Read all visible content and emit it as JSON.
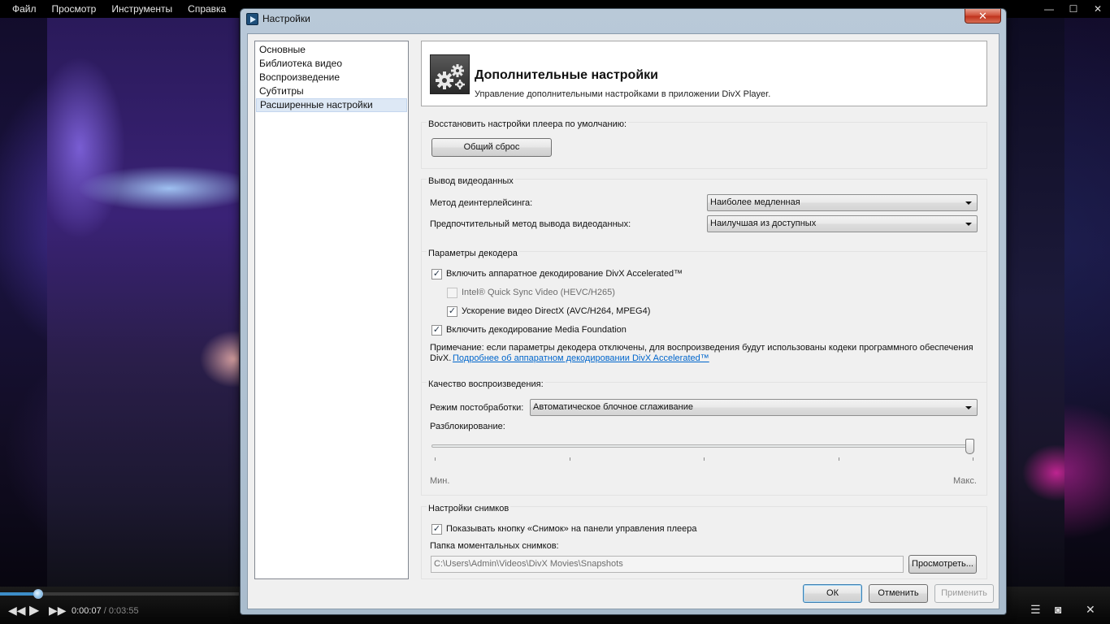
{
  "player": {
    "menu": [
      "Файл",
      "Просмотр",
      "Инструменты",
      "Справка"
    ],
    "window_controls": [
      "—",
      "☐",
      "✕"
    ],
    "time_current": "0:00:07",
    "time_total": " / 0:03:55",
    "progress_fraction": 0.033
  },
  "dialog": {
    "title": "Настройки",
    "close_label": "✕",
    "nav_items": [
      "Основные",
      "Библиотека видео",
      "Воспроизведение",
      "Субтитры",
      "Расширенные настройки"
    ],
    "selected_nav_index": 4,
    "header": {
      "title": "Дополнительные настройки",
      "subtitle": "Управление дополнительными настройками в приложении DivX Player."
    },
    "restore": {
      "legend": "Восстановить настройки плеера по умолчанию:",
      "reset_button": "Общий сброс"
    },
    "video_output": {
      "legend": "Вывод видеоданных",
      "deinterlace_label": "Метод деинтерлейсинга:",
      "deinterlace_value": "Наиболее медленная",
      "preferred_label": "Предпочтительный метод вывода видеоданных:",
      "preferred_value": "Наилучшая из доступных"
    },
    "decoder": {
      "legend": "Параметры декодера",
      "hw_decoding_label": "Включить аппаратное декодирование DivX Accelerated™",
      "hw_decoding_checked": true,
      "quick_sync_label": "Intel® Quick Sync Video (HEVC/H265)",
      "quick_sync_checked": false,
      "directx_label": "Ускорение видео DirectX (AVC/H264, MPEG4)",
      "directx_checked": true,
      "media_foundation_label": "Включить декодирование Media Foundation",
      "media_foundation_checked": true,
      "note_line1": "Примечание: если параметры декодера отключены, для воспроизведения будут использованы кодеки программного обеспечения",
      "note_line2": "DivX. ",
      "note_link": "Подробнее об аппаратном декодировании DivX Accelerated™"
    },
    "quality": {
      "legend": "Качество воспроизведения:",
      "postprocess_label": "Режим постобработки:",
      "postprocess_value": "Автоматическое блочное сглаживание",
      "deblock_label": "Разблокирование:",
      "deblock_level": 1.0,
      "min_label": "Мин.",
      "max_label": "Макс."
    },
    "snapshots": {
      "legend": "Настройки снимков",
      "show_button_label": "Показывать кнопку «Снимок» на панели управления плеера",
      "show_button_checked": true,
      "folder_label": "Папка моментальных снимков:",
      "folder_path": "C:\\Users\\Admin\\Videos\\DivX Movies\\Snapshots",
      "browse_button": "Просмотреть..."
    },
    "buttons": {
      "ok": "ОК",
      "cancel": "Отменить",
      "apply": "Применить"
    }
  }
}
